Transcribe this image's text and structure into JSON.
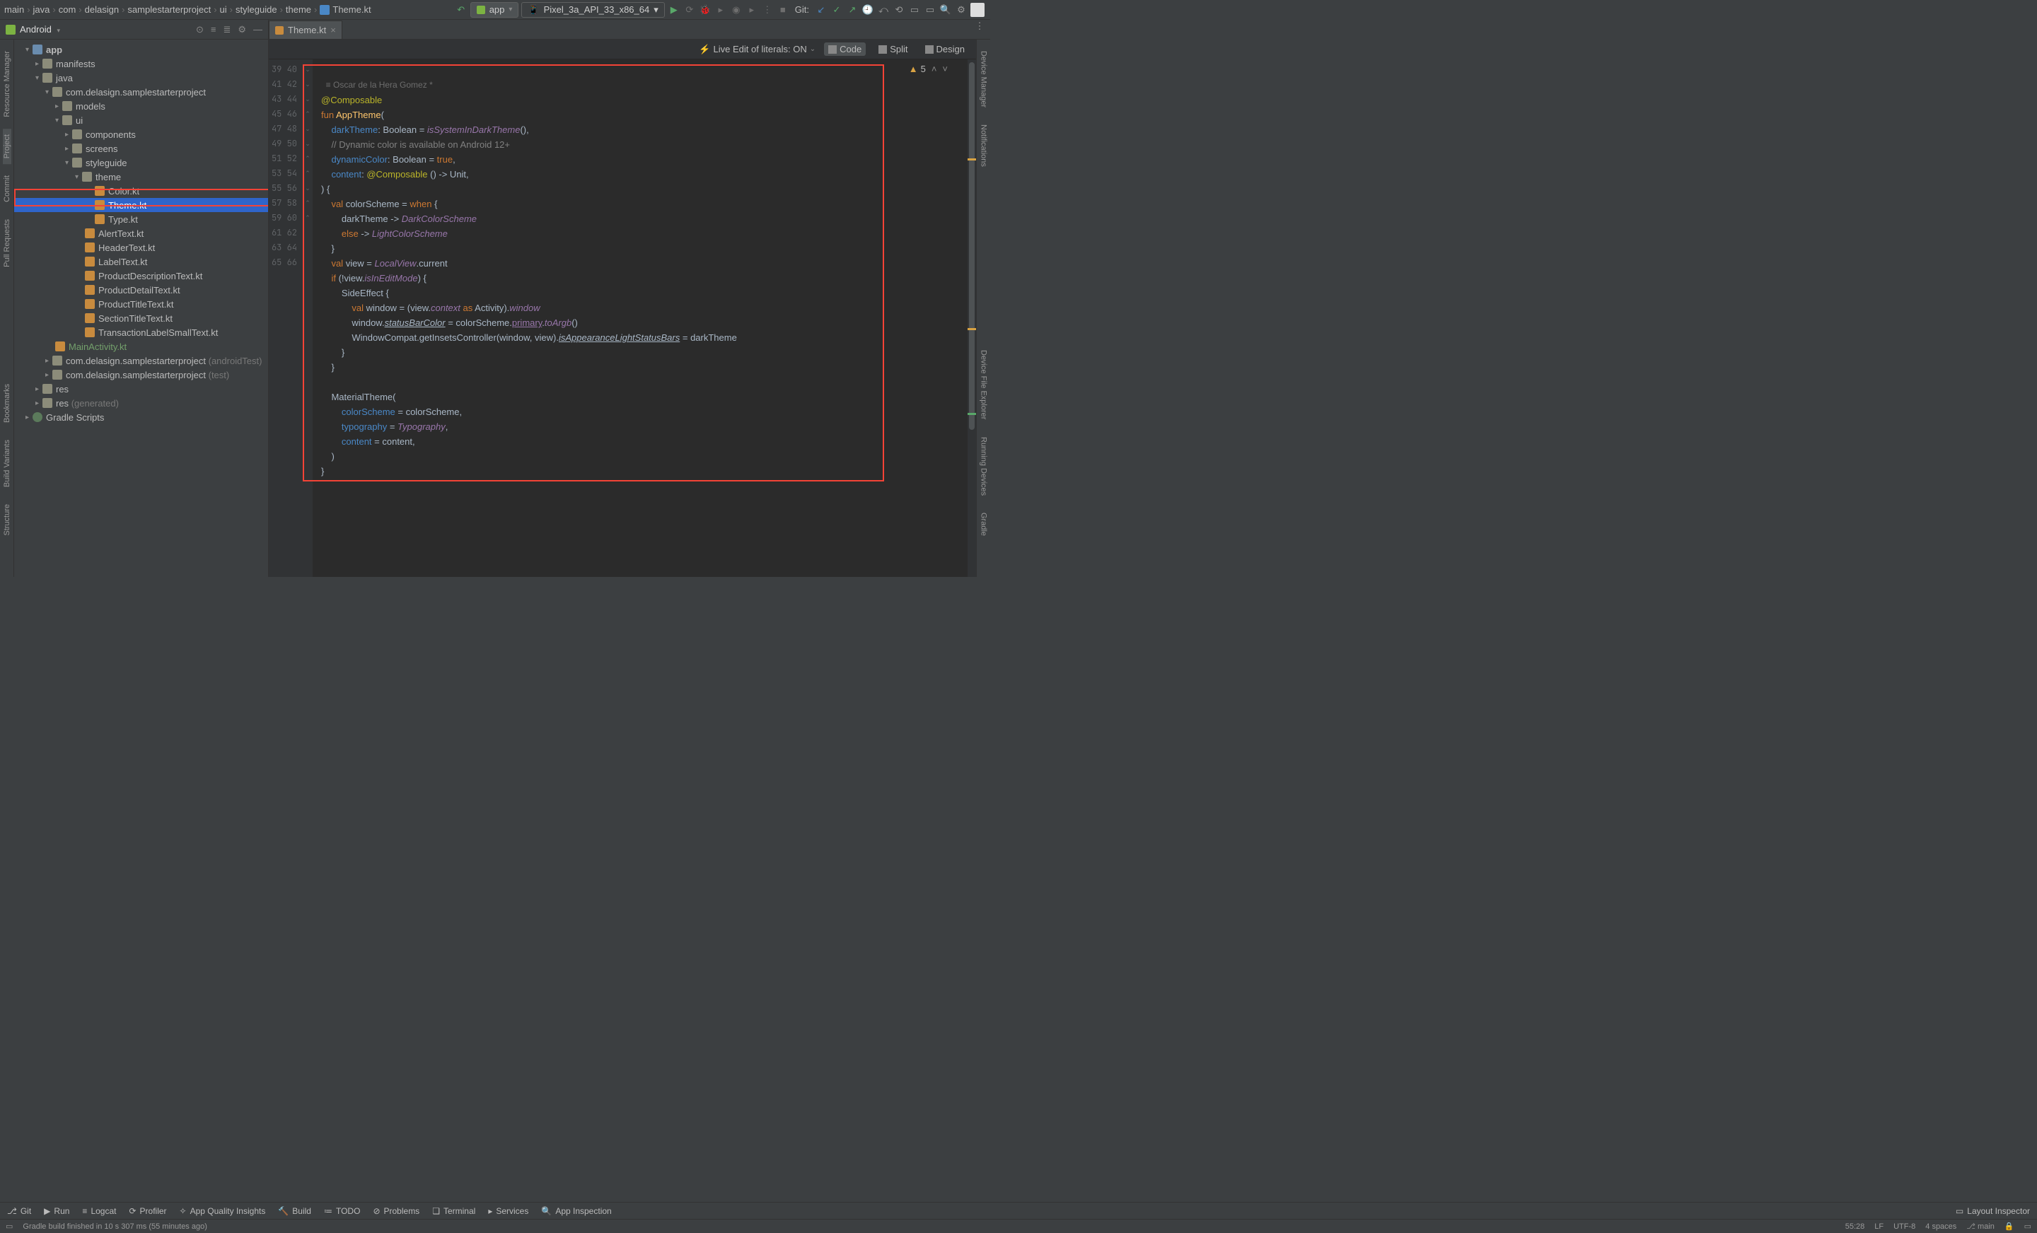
{
  "breadcrumbs": [
    "main",
    "java",
    "com",
    "delasign",
    "samplestarterproject",
    "ui",
    "styleguide",
    "theme",
    "Theme.kt"
  ],
  "runConfig": {
    "label": "app",
    "device": "Pixel_3a_API_33_x86_64"
  },
  "gitLabel": "Git:",
  "projectPanel": {
    "dropdown": "Android"
  },
  "tab": {
    "name": "Theme.kt"
  },
  "tree": {
    "root": "app",
    "manifests": "manifests",
    "java": "java",
    "pkgMain": "com.delasign.samplestarterproject",
    "models": "models",
    "ui": "ui",
    "components": "components",
    "screens": "screens",
    "styleguide": "styleguide",
    "theme": "theme",
    "colorkt": "Color.kt",
    "themekt": "Theme.kt",
    "typekt": "Type.kt",
    "alert": "AlertText.kt",
    "header": "HeaderText.kt",
    "label": "LabelText.kt",
    "pdesc": "ProductDescriptionText.kt",
    "pdetail": "ProductDetailText.kt",
    "ptitle": "ProductTitleText.kt",
    "section": "SectionTitleText.kt",
    "txlabel": "TransactionLabelSmallText.kt",
    "mainact": "MainActivity.kt",
    "pkgAndroidTest": "com.delasign.samplestarterproject",
    "pkgAndroidTestSuf": "(androidTest)",
    "pkgTest": "com.delasign.samplestarterproject",
    "pkgTestSuf": "(test)",
    "res": "res",
    "resGen": "res",
    "resGenSuf": "(generated)",
    "gradle": "Gradle Scripts"
  },
  "leftTools": [
    "Resource Manager",
    "Project",
    "Commit",
    "Pull Requests",
    "Bookmarks",
    "Build Variants",
    "Structure"
  ],
  "rightTools": [
    "Device Manager",
    "Notifications",
    "Device File Explorer",
    "Running Devices",
    "Gradle"
  ],
  "editorActions": {
    "liveEdit": "Live Edit of literals: ON",
    "code": "Code",
    "split": "Split",
    "design": "Design"
  },
  "warnCount": "5",
  "author": "Oscar de la Hera Gomez *",
  "gutterStart": 39,
  "gutterEnd": 66,
  "code": {
    "l40a": "@Composable",
    "l41_kw": "fun ",
    "l41_fn": "AppTheme",
    "l41_p": "(",
    "l42_na": "    darkTheme",
    "l42_c": ": Boolean = ",
    "l42_call": "isSystemInDarkTheme",
    "l42_tail": "(),",
    "l43": "    // Dynamic color is available on Android 12+",
    "l44_na": "    dynamicColor",
    "l44_c": ": Boolean = ",
    "l44_lit": "true",
    "l44_t": ",",
    "l45_na": "    content",
    "l45_c": ": ",
    "l45_an": "@Composable",
    "l45_t": " () -> Unit,",
    "l46": ") {",
    "l47_kw": "    val ",
    "l47_v": "colorScheme = ",
    "l47_when": "when ",
    "l47_b": "{",
    "l48_a": "        darkTheme -> ",
    "l48_b": "DarkColorScheme",
    "l49_kw": "        else ",
    "l49_ar": "-> ",
    "l49_it": "LightColorScheme",
    "l50": "    }",
    "l51_kw": "    val ",
    "l51_v": "view = ",
    "l51_it": "LocalView",
    "l51_t": ".current",
    "l52_kw": "    if ",
    "l52_a": "(!view.",
    "l52_it": "isInEditMode",
    "l52_t": ") {",
    "l53_a": "        SideEffect ",
    "l53_b": "{",
    "l54_kw": "            val ",
    "l54_a": "window = (view.",
    "l54_it": "context",
    "l54_as": " as ",
    "l54_t": "Activity).",
    "l54_it2": "window",
    "l55_a": "            window.",
    "l55_u": "statusBarColor",
    "l55_b": " = colorScheme.",
    "l55_u2": "primary",
    "l55_c": ".",
    "l55_it": "toArgb",
    "l55_d": "()",
    "l56_a": "            WindowCompat.getInsetsController(window, view).",
    "l56_u": "isAppearanceLightStatusBars",
    "l56_b": " = darkTheme",
    "l57": "        }",
    "l58": "    }",
    "l59": "",
    "l60_a": "    MaterialTheme(",
    "l61_na": "        colorScheme",
    "l61_b": " = colorScheme,",
    "l62_na": "        typography",
    "l62_b": " = ",
    "l62_it": "Typography",
    "l62_c": ",",
    "l63_na": "        content",
    "l63_b": " = content,",
    "l64": "    )",
    "l65": "}",
    "l66": ""
  },
  "bottomTools": {
    "git": "Git",
    "run": "Run",
    "logcat": "Logcat",
    "profiler": "Profiler",
    "appq": "App Quality Insights",
    "build": "Build",
    "todo": "TODO",
    "problems": "Problems",
    "terminal": "Terminal",
    "services": "Services",
    "appinsp": "App Inspection",
    "layoutinsp": "Layout Inspector"
  },
  "status": {
    "msg": "Gradle build finished in 10 s 307 ms (55 minutes ago)",
    "pos": "55:28",
    "le": "LF",
    "enc": "UTF-8",
    "indent": "4 spaces",
    "branch": "main"
  }
}
